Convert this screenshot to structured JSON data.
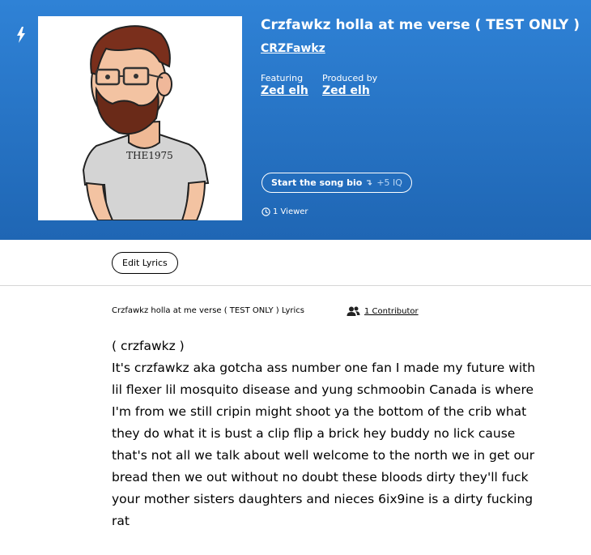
{
  "song": {
    "title": "Crzfawkz holla at me verse ( TEST ONLY )",
    "artist": "CRZFawkz",
    "featuring_label": "Featuring",
    "featuring": "Zed elh",
    "produced_by_label": "Produced by",
    "produced_by": "Zed elh",
    "art_shirt_text": "THE1975"
  },
  "bio": {
    "label": "Start the song bio",
    "iq": "+5 IQ"
  },
  "viewers": "1 Viewer",
  "edit_lyrics": "Edit Lyrics",
  "lyrics_header": {
    "title": "Crzfawkz holla at me verse ( TEST ONLY ) Lyrics",
    "contributors": "1 Contributor"
  },
  "lyrics": {
    "section": "( crzfawkz )",
    "text": "It's crzfawkz aka gotcha ass number one fan I made my future with lil flexer lil mosquito disease and yung schmoobin Canada is where I'm from we still cripin might shoot ya the bottom of the crib what they do what it is bust a clip flip a brick hey buddy no lick cause that's not all we talk about well welcome to the north we in get our bread then we out without no doubt these bloods dirty they'll fuck your mother sisters daughters and nieces 6ix9ine is a dirty fucking rat"
  },
  "colors": {
    "header_gradient_top": "#2f82d6",
    "header_gradient_bottom": "#1f66b4"
  }
}
